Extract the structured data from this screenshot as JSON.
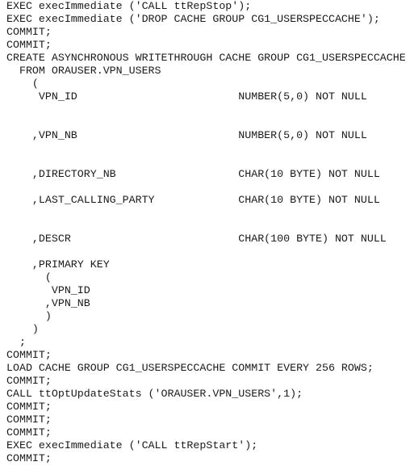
{
  "document": {
    "type": "sql-script-listing",
    "lines": [
      "EXEC execImmediate ('CALL ttRepStop');",
      "EXEC execImmediate ('DROP CACHE GROUP CG1_USERSPECCACHE');",
      "COMMIT;",
      "COMMIT;",
      "CREATE ASYNCHRONOUS WRITETHROUGH CACHE GROUP CG1_USERSPECCACHE",
      "  FROM ORAUSER.VPN_USERS",
      "    (",
      "     VPN_ID                         NUMBER(5,0) NOT NULL",
      "",
      "",
      "    ,VPN_NB                         NUMBER(5,0) NOT NULL",
      "",
      "",
      "    ,DIRECTORY_NB                   CHAR(10 BYTE) NOT NULL",
      "",
      "    ,LAST_CALLING_PARTY             CHAR(10 BYTE) NOT NULL",
      "",
      "",
      "    ,DESCR                          CHAR(100 BYTE) NOT NULL",
      "",
      "    ,PRIMARY KEY",
      "      (",
      "       VPN_ID",
      "      ,VPN_NB",
      "      )",
      "    )",
      "  ;",
      "COMMIT;",
      "LOAD CACHE GROUP CG1_USERSPECCACHE COMMIT EVERY 256 ROWS;",
      "COMMIT;",
      "CALL ttOptUpdateStats ('ORAUSER.VPN_USERS',1);",
      "COMMIT;",
      "COMMIT;",
      "COMMIT;",
      "EXEC execImmediate ('CALL ttRepStart');",
      "COMMIT;"
    ]
  }
}
